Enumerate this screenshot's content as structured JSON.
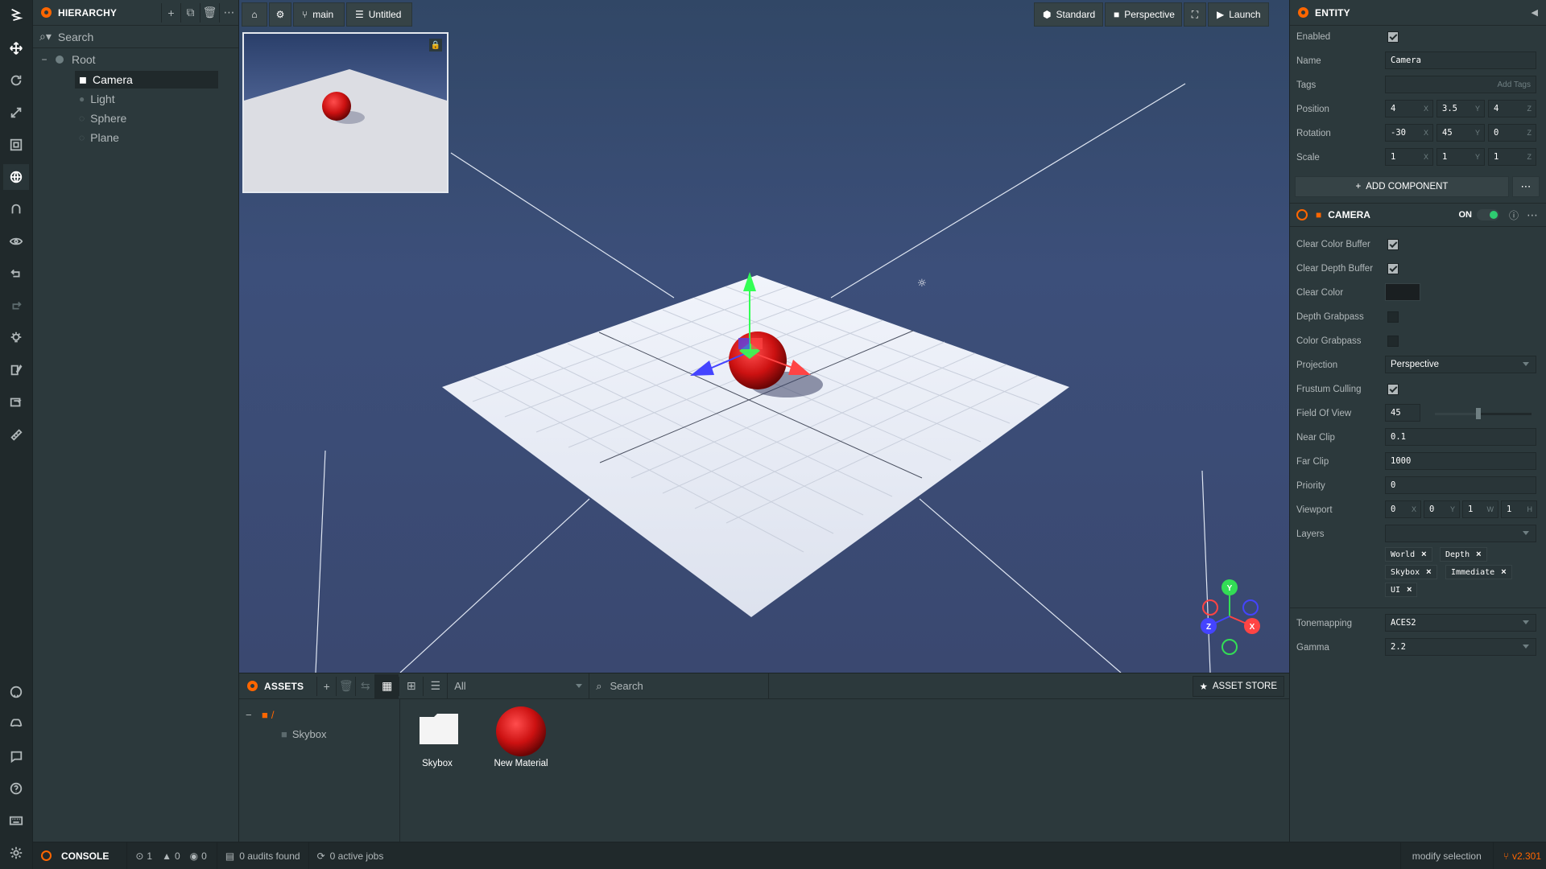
{
  "toolbar": {
    "tools": [
      "logo-icon",
      "move-icon",
      "rotate-icon",
      "scale-icon",
      "resize-icon",
      "world-icon",
      "snap-icon",
      "focus-icon",
      "undo-icon",
      "redo-icon",
      "bake-icon",
      "code-icon",
      "build-icon",
      "publish-icon"
    ],
    "bottom": [
      "github-icon",
      "discord-icon",
      "feedback-icon",
      "help-icon",
      "keyboard-icon",
      "settings-icon"
    ]
  },
  "hierarchy": {
    "title": "HIERARCHY",
    "search_placeholder": "Search",
    "items": [
      {
        "label": "Root"
      },
      {
        "label": "Camera"
      },
      {
        "label": "Light"
      },
      {
        "label": "Sphere"
      },
      {
        "label": "Plane"
      }
    ]
  },
  "viewport": {
    "branch": "main",
    "checkpoint": "Untitled",
    "render_mode": "Standard",
    "camera": "Perspective",
    "launch": "Launch",
    "gizmo": {
      "y": "Y",
      "x": "X",
      "z": "Z"
    }
  },
  "inspector": {
    "entity_title": "ENTITY",
    "enabled_label": "Enabled",
    "name_label": "Name",
    "name_value": "Camera",
    "tags_label": "Tags",
    "tags_placeholder": "Add Tags",
    "position_label": "Position",
    "position": [
      "4",
      "3.5",
      "4"
    ],
    "rotation_label": "Rotation",
    "rotation": [
      "-30",
      "45",
      "0"
    ],
    "scale_label": "Scale",
    "scale": [
      "1",
      "1",
      "1"
    ],
    "axes": [
      "X",
      "Y",
      "Z"
    ],
    "add_component": "ADD COMPONENT",
    "camera_title": "CAMERA",
    "camera_on": "ON",
    "clear_color_buffer": "Clear Color Buffer",
    "clear_depth_buffer": "Clear Depth Buffer",
    "clear_color": "Clear Color",
    "depth_grabpass": "Depth Grabpass",
    "color_grabpass": "Color Grabpass",
    "projection_label": "Projection",
    "projection_value": "Perspective",
    "frustum_culling": "Frustum Culling",
    "fov_label": "Field Of View",
    "fov_value": "45",
    "fov_slider_fraction": 0.45,
    "near_clip_label": "Near Clip",
    "near_clip_value": "0.1",
    "far_clip_label": "Far Clip",
    "far_clip_value": "1000",
    "priority_label": "Priority",
    "priority_value": "0",
    "viewport_label": "Viewport",
    "viewport_values": [
      "0",
      "0",
      "1",
      "1"
    ],
    "viewport_axes": [
      "X",
      "Y",
      "W",
      "H"
    ],
    "layers_label": "Layers",
    "layers": [
      "World",
      "Depth",
      "Skybox",
      "Immediate",
      "UI"
    ],
    "tonemapping_label": "Tonemapping",
    "tonemapping_value": "ACES2",
    "gamma_label": "Gamma",
    "gamma_value": "2.2"
  },
  "assets": {
    "title": "ASSETS",
    "filter": "All",
    "search_placeholder": "Search",
    "store": "ASSET STORE",
    "tree_root": "/",
    "tree_folder": "Skybox",
    "items": [
      {
        "label": "Skybox"
      },
      {
        "label": "New Material"
      }
    ]
  },
  "status": {
    "console": "CONSOLE",
    "errors": "1",
    "warnings": "0",
    "info": "0",
    "audits": "0 audits found",
    "jobs": "0 active jobs",
    "message": "modify selection",
    "version": "v2.301"
  },
  "colors": {
    "accent": "#ff6600",
    "panel": "#2c393c",
    "dark": "#20292b",
    "green": "#2ecc71"
  }
}
